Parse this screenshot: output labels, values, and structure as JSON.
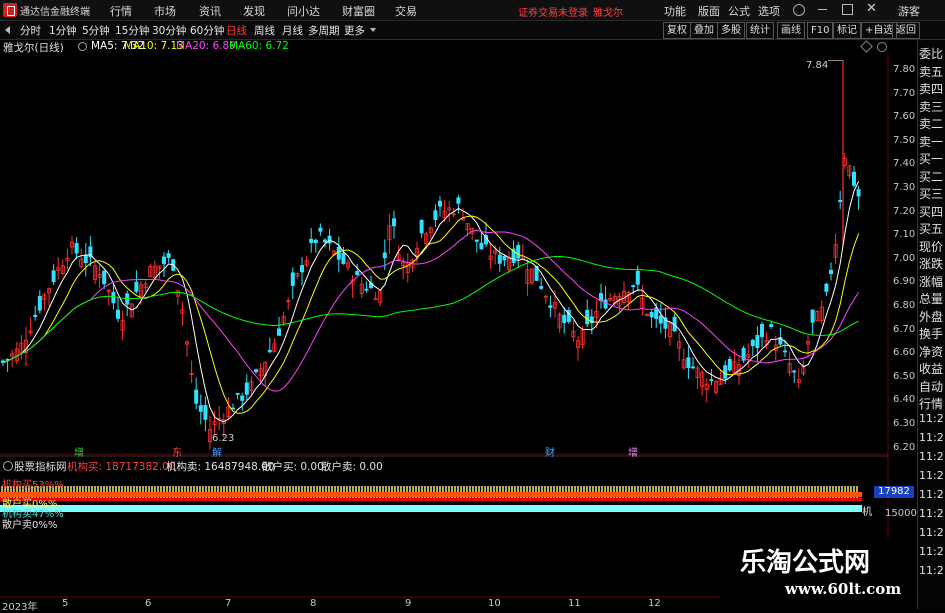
{
  "topbar": {
    "app_title": "通达信金融终端",
    "menus": [
      "行情",
      "市场",
      "资讯",
      "发现",
      "问小达",
      "财富圈",
      "交易"
    ],
    "login_notice": "证券交易未登录",
    "stock_tab": "雅戈尔",
    "right_menus": [
      "功能",
      "版面",
      "公式",
      "选项"
    ],
    "guest": "游客"
  },
  "periodbar": {
    "periods": [
      "分时",
      "1分钟",
      "5分钟",
      "15分钟",
      "30分钟",
      "60分钟",
      "日线",
      "周线",
      "月线",
      "多周期",
      "更多"
    ],
    "selected_index": 6,
    "right_buttons": [
      "复权",
      "叠加",
      "多股",
      "统计",
      "画线",
      "F10",
      "标记",
      "+自选",
      "返回"
    ]
  },
  "mabar": {
    "stock": "雅戈尔(日线)",
    "ma5": "MA5: 7.32",
    "ma10": "MA10: 7.13",
    "ma20": "MA20: 6.89",
    "ma60": "MA60: 6.72",
    "colors": {
      "ma5": "#ffffff",
      "ma10": "#ffff00",
      "ma20": "#ff40ff",
      "ma60": "#00ff00"
    }
  },
  "price_axis": [
    "7.80",
    "7.70",
    "7.60",
    "7.50",
    "7.40",
    "7.30",
    "7.20",
    "7.10",
    "7.00",
    "6.90",
    "6.80",
    "6.70",
    "6.60",
    "6.50",
    "6.40",
    "6.30",
    "6.20"
  ],
  "annotations": {
    "high": "7.84",
    "low": "6.23"
  },
  "event_marks": [
    {
      "text": "增",
      "color": "#30d030"
    },
    {
      "text": "东",
      "color": "#ff4040"
    },
    {
      "text": "解",
      "color": "#40a0ff"
    },
    {
      "text": "财",
      "color": "#40a0ff"
    },
    {
      "text": "增",
      "color": "#ff80ff"
    }
  ],
  "indicator": {
    "name": "股票指标网",
    "jgm_label": "机构买: 18717382.00",
    "jgs_label": "机构卖: 16487948.00",
    "shm_label": "散户买: 0.00",
    "shs_label": "散户卖: 0.00",
    "legend_jgm": "机构买53%%",
    "legend_jgs": "机构卖47%%",
    "legend_shm": "散户买0%%",
    "legend_shs": "散户卖0%%",
    "axis_value": "17982",
    "axis_value2": "15000",
    "tag": "机"
  },
  "x_axis": [
    "2023年",
    "5",
    "6",
    "7",
    "8",
    "9",
    "10",
    "11",
    "12"
  ],
  "side_panel": [
    "委比",
    "卖五",
    "卖四",
    "卖三",
    "卖二",
    "卖一",
    "买一",
    "买二",
    "买三",
    "买四",
    "买五",
    "现价",
    "涨跌",
    "涨幅",
    "总量",
    "外盘",
    "换手",
    "净资",
    "收益",
    "自动",
    "行情",
    "11:2",
    "11:2",
    "11:2",
    "11:2",
    "11:2",
    "11:2",
    "11:2",
    "11:2",
    "11:2"
  ],
  "watermark": {
    "line1": "乐淘公式网",
    "line2": "www.60lt.com"
  }
}
